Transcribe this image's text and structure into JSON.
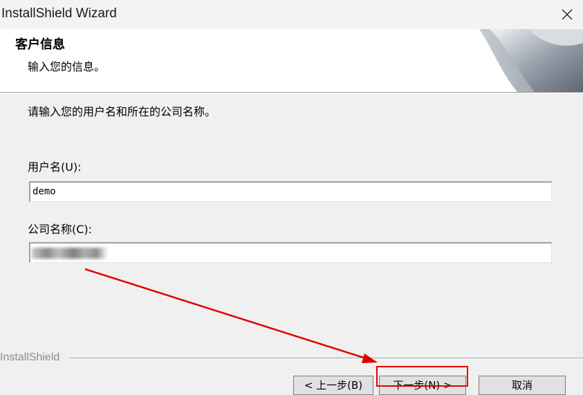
{
  "window": {
    "title": "InstallShield Wizard"
  },
  "header": {
    "title": "客户信息",
    "subtitle": "输入您的信息。"
  },
  "body": {
    "instruction": "请输入您的用户名和所在的公司名称。"
  },
  "fields": {
    "username": {
      "label": "用户名(U):",
      "value": "demo"
    },
    "company": {
      "label": "公司名称(C):",
      "value": ""
    }
  },
  "footer": {
    "brand": "InstallShield"
  },
  "buttons": {
    "back": "< 上一步(B)",
    "next": "下一步(N) >",
    "cancel": "取消"
  },
  "colors": {
    "annotation": "#e00000",
    "window_bg": "#f0f0f0"
  },
  "icons": {
    "close": "close-icon"
  }
}
